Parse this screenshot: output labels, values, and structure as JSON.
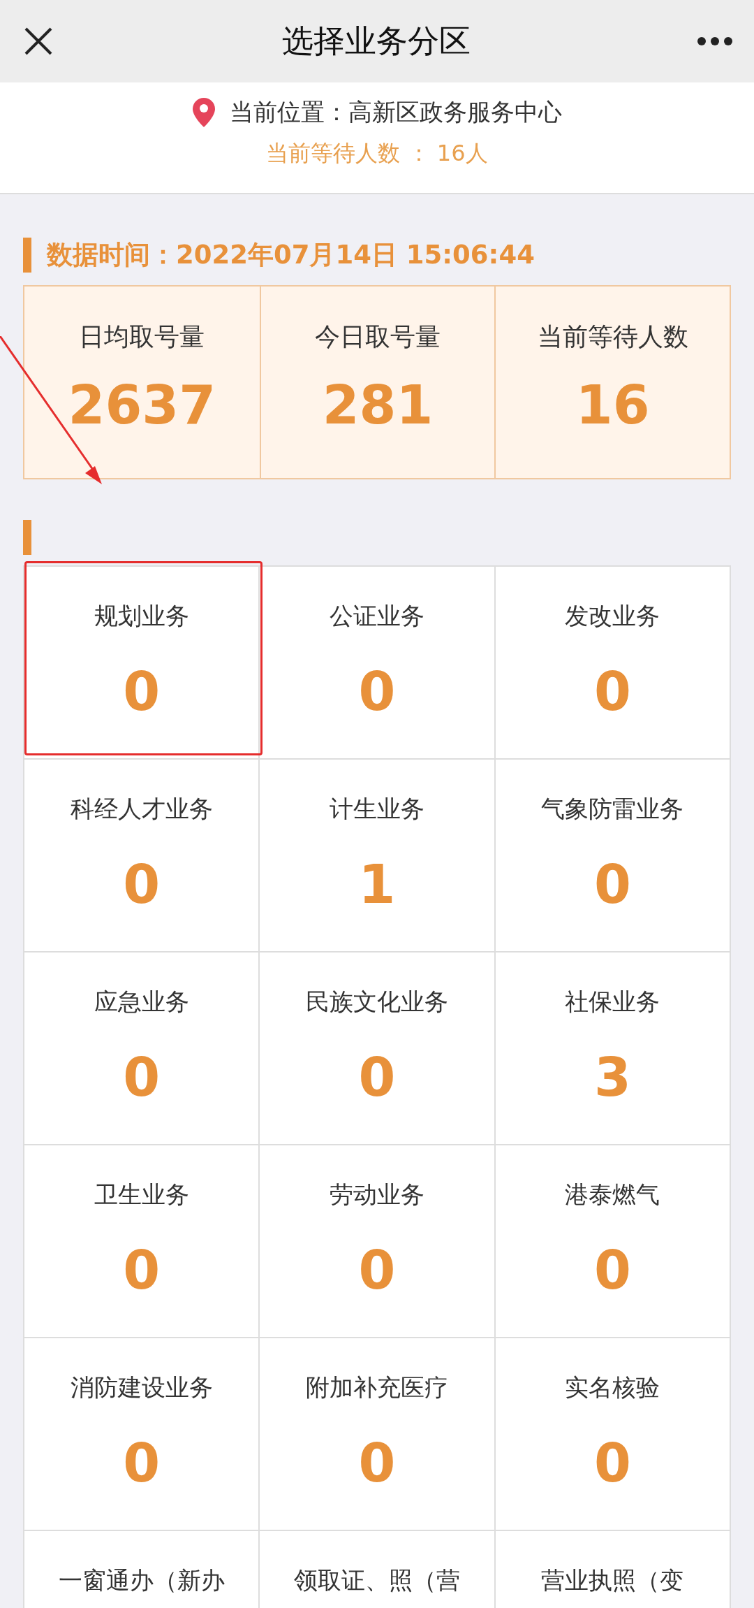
{
  "header": {
    "title": "选择业务分区"
  },
  "location": {
    "label": "当前位置：高新区政务服务中心",
    "waiting": "当前等待人数 ： 16人"
  },
  "data_time": "数据时间：2022年07月14日 15:06:44",
  "stats": [
    {
      "label": "日均取号量",
      "value": "2637"
    },
    {
      "label": "今日取号量",
      "value": "281"
    },
    {
      "label": "当前等待人数",
      "value": "16"
    }
  ],
  "services": [
    {
      "name": "规划业务",
      "count": "0",
      "highlighted": true
    },
    {
      "name": "公证业务",
      "count": "0",
      "highlighted": false
    },
    {
      "name": "发改业务",
      "count": "0",
      "highlighted": false
    },
    {
      "name": "科经人才业务",
      "count": "0",
      "highlighted": false
    },
    {
      "name": "计生业务",
      "count": "1",
      "highlighted": false
    },
    {
      "name": "气象防雷业务",
      "count": "0",
      "highlighted": false
    },
    {
      "name": "应急业务",
      "count": "0",
      "highlighted": false
    },
    {
      "name": "民族文化业务",
      "count": "0",
      "highlighted": false
    },
    {
      "name": "社保业务",
      "count": "3",
      "highlighted": false
    },
    {
      "name": "卫生业务",
      "count": "0",
      "highlighted": false
    },
    {
      "name": "劳动业务",
      "count": "0",
      "highlighted": false
    },
    {
      "name": "港泰燃气",
      "count": "0",
      "highlighted": false
    },
    {
      "name": "消防建设业务",
      "count": "0",
      "highlighted": false
    },
    {
      "name": "附加补充医疗",
      "count": "0",
      "highlighted": false
    },
    {
      "name": "实名核验",
      "count": "0",
      "highlighted": false
    },
    {
      "name": "一窗通办（新办",
      "highlighted": false
    },
    {
      "name": "领取证、照（营",
      "highlighted": false
    },
    {
      "name": "营业执照（变",
      "highlighted": false
    }
  ]
}
